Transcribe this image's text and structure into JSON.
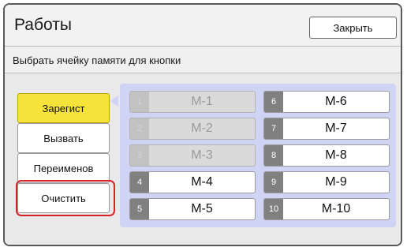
{
  "window": {
    "title": "Работы",
    "close_label": "Закрыть"
  },
  "subtitle": "Выбрать ячейку памяти для кнопки",
  "actions": [
    {
      "label": "Зарегист",
      "active": true
    },
    {
      "label": "Вызвать",
      "active": false
    },
    {
      "label": "Переименов",
      "active": false
    },
    {
      "label": "Очистить",
      "active": false,
      "highlighted": true
    }
  ],
  "memory_slots": [
    {
      "number": "1",
      "name": "M-1",
      "enabled": false
    },
    {
      "number": "2",
      "name": "M-2",
      "enabled": false
    },
    {
      "number": "3",
      "name": "M-3",
      "enabled": false
    },
    {
      "number": "4",
      "name": "M-4",
      "enabled": true
    },
    {
      "number": "5",
      "name": "M-5",
      "enabled": true
    },
    {
      "number": "6",
      "name": "M-6",
      "enabled": true
    },
    {
      "number": "7",
      "name": "M-7",
      "enabled": true
    },
    {
      "number": "8",
      "name": "M-8",
      "enabled": true
    },
    {
      "number": "9",
      "name": "M-9",
      "enabled": true
    },
    {
      "number": "10",
      "name": "M-10",
      "enabled": true
    }
  ],
  "colors": {
    "accent_yellow": "#f5e33a",
    "panel_lavender": "#cfd3f4",
    "highlight_red": "#d8222a"
  }
}
